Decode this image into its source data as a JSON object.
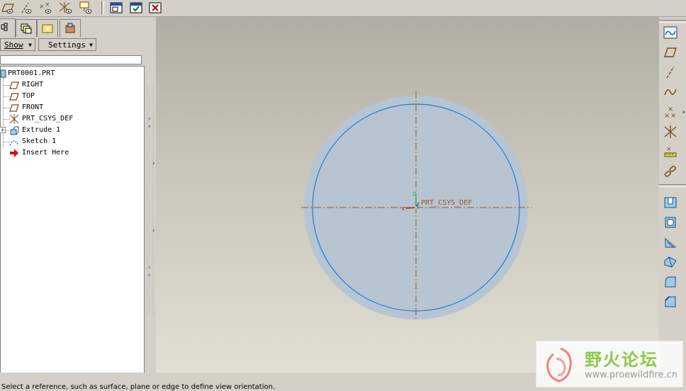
{
  "toolbar": {
    "icons": [
      "plane-visibility-icon",
      "axis-visibility-icon",
      "point-visibility-icon",
      "csys-visibility-icon",
      "annotation-visibility-icon",
      "repaint-icon",
      "orient-ok-icon",
      "cancel-icon"
    ]
  },
  "navigator": {
    "tabs": [
      "model-tree-tab",
      "layers-tab",
      "folder-browser-tab",
      "favorites-tab"
    ],
    "show_label": "Show",
    "settings_label": "Settings"
  },
  "model_tree": {
    "items": [
      {
        "label": "PRT0001.PRT",
        "icon": "part-icon"
      },
      {
        "label": "RIGHT",
        "icon": "datum-plane-icon"
      },
      {
        "label": "TOP",
        "icon": "datum-plane-icon"
      },
      {
        "label": "FRONT",
        "icon": "datum-plane-icon"
      },
      {
        "label": "PRT_CSYS_DEF",
        "icon": "csys-icon"
      },
      {
        "label": "Extrude 1",
        "icon": "extrude-icon"
      },
      {
        "label": "Sketch 1",
        "icon": "sketch-icon"
      },
      {
        "label": "Insert Here",
        "icon": "insert-arrow-icon"
      }
    ]
  },
  "viewport": {
    "csys_label": "PRT_CSYS_DEF",
    "x_label": "X",
    "y_label": "Y",
    "z_label": "Z"
  },
  "right_toolbar": {
    "icons": [
      "sketch-tool-icon",
      "datum-plane-tool-icon",
      "datum-axis-tool-icon",
      "datum-curve-tool-icon",
      "datum-point-tool-icon",
      "csys-tool-icon",
      "analysis-tool-icon",
      "chain-tool-icon",
      "hole-tool-icon",
      "shell-tool-icon",
      "rib-tool-icon",
      "draft-tool-icon",
      "round-tool-icon",
      "chamfer-tool-icon"
    ]
  },
  "status": {
    "message": "Select a reference, such as surface, plane or edge to define view orientation."
  },
  "watermark": {
    "title": "野火论坛",
    "url": "www.proewildfire.cn"
  },
  "colors": {
    "viewport_top": "#b1ada4",
    "viewport_bottom": "#e1dfd3",
    "part_fill": "#b6c5d1",
    "edge_blue": "#1b7be0",
    "datum_brown": "#a4521e"
  }
}
